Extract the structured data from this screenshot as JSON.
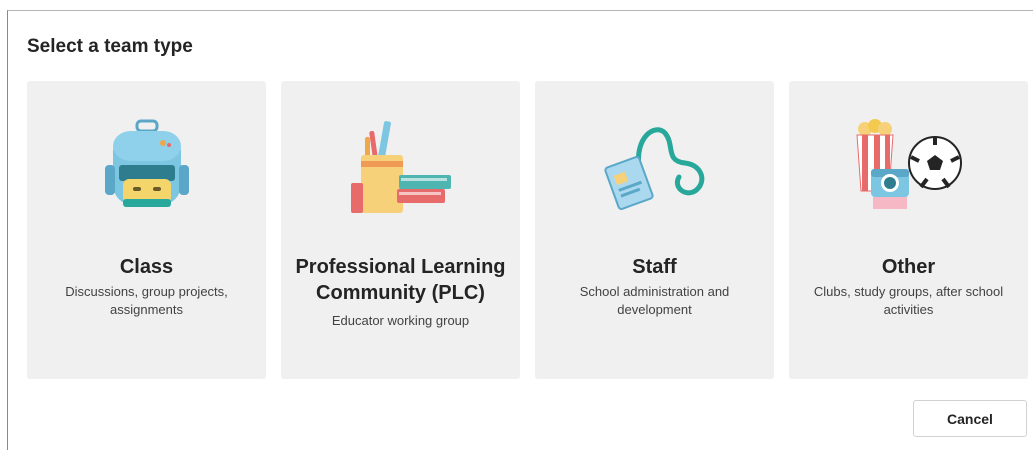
{
  "dialog": {
    "title": "Select a team type",
    "cards": [
      {
        "name": "Class",
        "description": "Discussions, group projects, assignments",
        "icon": "backpack-icon"
      },
      {
        "name": "Professional Learning Community (PLC)",
        "description": "Educator working group",
        "icon": "books-pencils-icon"
      },
      {
        "name": "Staff",
        "description": "School administration and development",
        "icon": "lanyard-badge-icon"
      },
      {
        "name": "Other",
        "description": "Clubs, study groups, after school activities",
        "icon": "popcorn-ball-camera-icon"
      }
    ],
    "cancel_label": "Cancel"
  }
}
